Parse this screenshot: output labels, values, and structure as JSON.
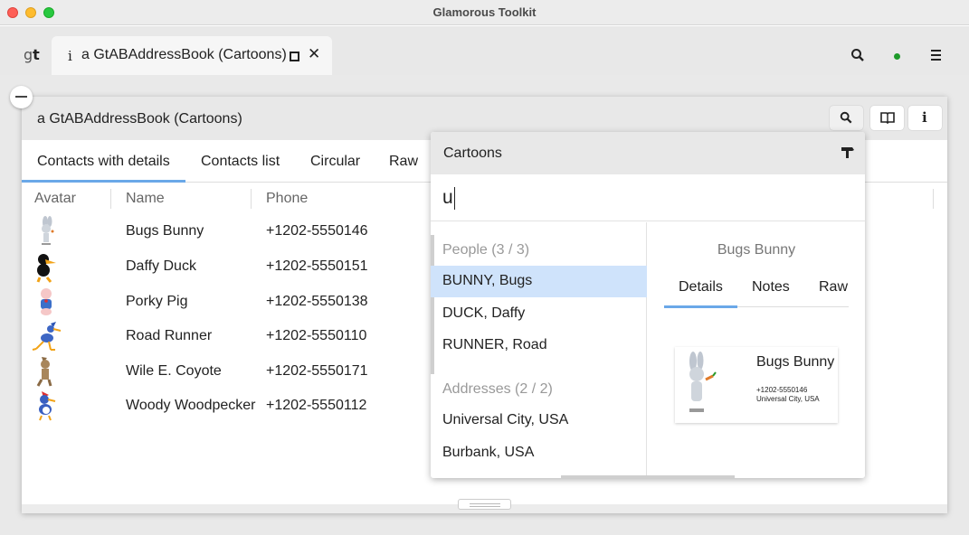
{
  "window": {
    "title": "Glamorous Toolkit"
  },
  "tabbar": {
    "logo": "gt",
    "active_tab": {
      "icon": "info-icon",
      "label": "a GtABAddressBook (Cartoons)"
    }
  },
  "pane": {
    "title": "a GtABAddressBook (Cartoons)",
    "view_tabs": [
      "Contacts with details",
      "Contacts list",
      "Circular",
      "Raw"
    ],
    "columns": [
      "Avatar",
      "Name",
      "Phone"
    ],
    "rows": [
      {
        "name": "Bugs Bunny",
        "phone": "+1202-5550146",
        "avatar": "bugs-bunny-avatar"
      },
      {
        "name": "Daffy Duck",
        "phone": "+1202-5550151",
        "avatar": "daffy-duck-avatar"
      },
      {
        "name": "Porky Pig",
        "phone": "+1202-5550138",
        "avatar": "porky-pig-avatar"
      },
      {
        "name": "Road Runner",
        "phone": "+1202-5550110",
        "avatar": "road-runner-avatar"
      },
      {
        "name": "Wile E. Coyote",
        "phone": "+1202-5550171",
        "avatar": "wile-e-coyote-avatar"
      },
      {
        "name": "Woody Woodpecker",
        "phone": "+1202-5550112",
        "avatar": "woody-woodpecker-avatar"
      }
    ]
  },
  "spotter": {
    "title": "Cartoons",
    "query": "u",
    "people_header": "People (3 / 3)",
    "people": [
      "BUNNY, Bugs",
      "DUCK, Daffy",
      "RUNNER, Road"
    ],
    "addresses_header": "Addresses (2 / 2)",
    "addresses": [
      "Universal City, USA",
      "Burbank, USA"
    ],
    "preview": {
      "title": "Bugs Bunny",
      "tabs": [
        "Details",
        "Notes",
        "Raw"
      ],
      "card_name": "Bugs Bunny",
      "card_phone": "+1202-5550146",
      "card_address": "Universal City, USA"
    }
  },
  "colors": {
    "accent": "#6aa8e8",
    "selection": "#cfe3fb",
    "status_dot": "#1d9a2a"
  }
}
